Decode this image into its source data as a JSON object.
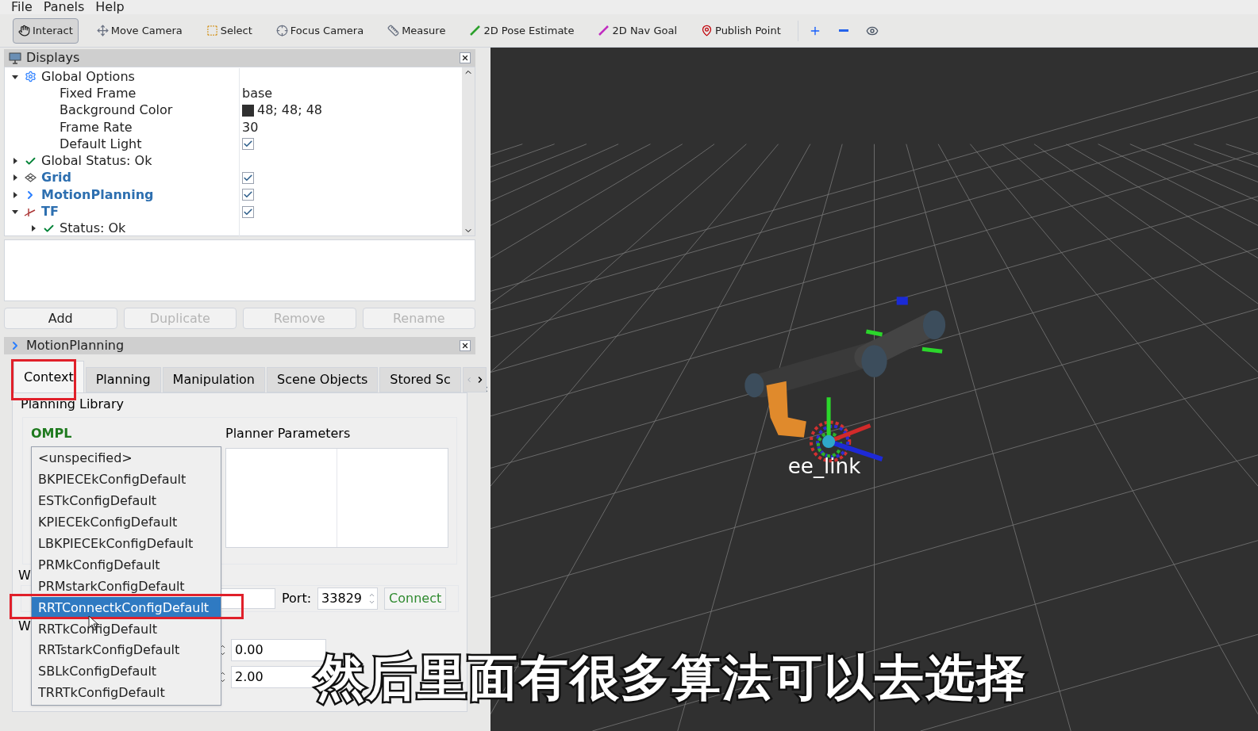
{
  "menu": [
    "File",
    "Panels",
    "Help"
  ],
  "toolbar": {
    "tools": [
      {
        "label": "Interact",
        "selected": true
      },
      {
        "label": "Move Camera",
        "selected": false
      },
      {
        "label": "Select",
        "selected": false
      },
      {
        "label": "Focus Camera",
        "selected": false
      },
      {
        "label": "Measure",
        "selected": false
      },
      {
        "label": "2D Pose Estimate",
        "selected": false
      },
      {
        "label": "2D Nav Goal",
        "selected": false
      },
      {
        "label": "Publish Point",
        "selected": false
      }
    ]
  },
  "displays": {
    "title": "Displays",
    "tree": [
      {
        "label": "Global Options",
        "expanded": true,
        "children": [
          {
            "label": "Fixed Frame",
            "value": "base"
          },
          {
            "label": "Background Color",
            "value": "48; 48; 48",
            "color": "#303030"
          },
          {
            "label": "Frame Rate",
            "value": "30"
          },
          {
            "label": "Default Light",
            "checked": true
          }
        ]
      },
      {
        "label": "Global Status: Ok",
        "expanded": false
      },
      {
        "label": "Grid",
        "expanded": false,
        "link": true,
        "checked": true
      },
      {
        "label": "MotionPlanning",
        "expanded": false,
        "link": true,
        "checked": true
      },
      {
        "label": "TF",
        "expanded": true,
        "link": true,
        "checked": true,
        "children": [
          {
            "label": "Status: Ok",
            "expanded": false
          }
        ]
      }
    ],
    "buttons": [
      {
        "label": "Add",
        "disabled": false
      },
      {
        "label": "Duplicate",
        "disabled": true
      },
      {
        "label": "Remove",
        "disabled": true
      },
      {
        "label": "Rename",
        "disabled": true
      }
    ]
  },
  "motion_planning": {
    "title": "MotionPlanning",
    "tabs": [
      {
        "label": "Context",
        "selected": true
      },
      {
        "label": "Planning",
        "selected": false
      },
      {
        "label": "Manipulation",
        "selected": false
      },
      {
        "label": "Scene Objects",
        "selected": false
      },
      {
        "label": "Stored Sc",
        "selected": false
      }
    ],
    "section": "Planning Library",
    "library": "OMPL",
    "params_label": "Planner Parameters",
    "hidden_labels": [
      "W",
      "W"
    ],
    "port_label": "Port:",
    "port": "33829",
    "connect": "Connect",
    "spin_values": [
      "0.00",
      "2.00"
    ],
    "planners": [
      {
        "label": "<unspecified>",
        "selected": false
      },
      {
        "label": "BKPIECEkConfigDefault",
        "selected": false
      },
      {
        "label": "ESTkConfigDefault",
        "selected": false
      },
      {
        "label": "KPIECEkConfigDefault",
        "selected": false
      },
      {
        "label": "LBKPIECEkConfigDefault",
        "selected": false
      },
      {
        "label": "PRMkConfigDefault",
        "selected": false
      },
      {
        "label": "PRMstarkConfigDefault",
        "selected": false
      },
      {
        "label": "RRTConnectkConfigDefault",
        "selected": true
      },
      {
        "label": "RRTkConfigDefault",
        "selected": false
      },
      {
        "label": "RRTstarkConfigDefault",
        "selected": false
      },
      {
        "label": "SBLkConfigDefault",
        "selected": false
      },
      {
        "label": "TRRTkConfigDefault",
        "selected": false
      }
    ]
  },
  "viewport": {
    "frame_label": "ee_link"
  },
  "subtitle": "然后里面有很多算法可以去选择"
}
